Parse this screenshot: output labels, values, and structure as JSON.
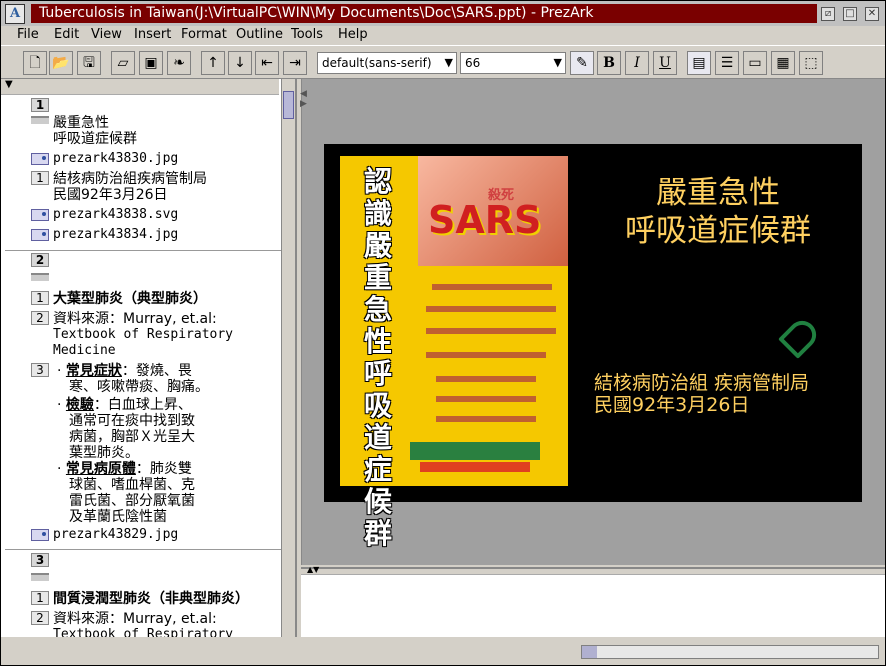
{
  "window": {
    "title": "Tuberculosis in Taiwan(J:\\VirtualPC\\WIN\\My Documents\\Doc\\SARS.ppt) - PrezArk",
    "app_icon": "PrezArk logo"
  },
  "menu": [
    "File",
    "Edit",
    "View",
    "Insert",
    "Format",
    "Outline",
    "Tools",
    "Help"
  ],
  "toolbar": {
    "font_family": "default(sans-serif)",
    "font_size": "66",
    "bold": "B",
    "italic": "I",
    "underline": "U"
  },
  "outline": [
    {
      "kind": "slide",
      "num": "1",
      "top": 0
    },
    {
      "kind": "blank",
      "text": "嚴重急性\n呼吸道症候群"
    },
    {
      "kind": "image",
      "text": "prezark43830.jpg"
    },
    {
      "kind": "level",
      "num": "1",
      "text": "結核病防治組疾病管制局\n民國92年3月26日"
    },
    {
      "kind": "image",
      "text": "prezark43838.svg"
    },
    {
      "kind": "image",
      "text": "prezark43834.jpg"
    }
  ],
  "outline_items": {
    "s1_num": "1",
    "s1_title": "嚴重急性",
    "s1_title2": "呼吸道症候群",
    "s1_img1": "prezark43830.jpg",
    "s1_sub_num": "1",
    "s1_sub1": "結核病防治組疾病管制局",
    "s1_sub2": "民國92年3月26日",
    "s1_img2": "prezark43838.svg",
    "s1_img3": "prezark43834.jpg",
    "s2_num": "2",
    "s2_h_num": "1",
    "s2_h": "大葉型肺炎（典型肺炎）",
    "s2_src_num": "2",
    "s2_src1": "資料來源：Murray, et.al:",
    "s2_src2": "Textbook of Respiratory",
    "s2_src3": "Medicine",
    "s2_list_num": "3",
    "s2_b1_label": "常見症狀",
    "s2_b1_rest": "：發燒、畏",
    "s2_b1_l2": "寒、咳嗽帶痰、胸痛。",
    "s2_b2_label": "檢驗",
    "s2_b2_rest": "：白血球上昇、",
    "s2_b2_l2": "通常可在痰中找到致",
    "s2_b2_l3": "病菌，胸部Ｘ光呈大",
    "s2_b2_l4": "葉型肺炎。",
    "s2_b3_label": "常見病原體",
    "s2_b3_rest": "：肺炎雙",
    "s2_b3_l2": "球菌、嗜血桿菌、克",
    "s2_b3_l3": "雷氏菌、部分厭氧菌",
    "s2_b3_l4": "及革蘭氏陰性菌",
    "s2_img": "prezark43829.jpg",
    "s3_num": "3",
    "s3_h_num": "1",
    "s3_h": "間質浸潤型肺炎（非典型肺炎）",
    "s3_src_num": "2",
    "s3_src1": "資料來源：Murray, et.al:",
    "s3_src2": "Textbook of Respiratory"
  },
  "slide": {
    "title1": "嚴重急性",
    "title2": "呼吸道症候群",
    "sub1": "結核病防治組 疾病管制局",
    "sub2": "民國92年3月26日",
    "poster_vertical": "認識嚴重急性呼吸道症候群",
    "poster_logo": "SARS",
    "poster_stamp": "殺死"
  },
  "progress_fraction": 0.05
}
